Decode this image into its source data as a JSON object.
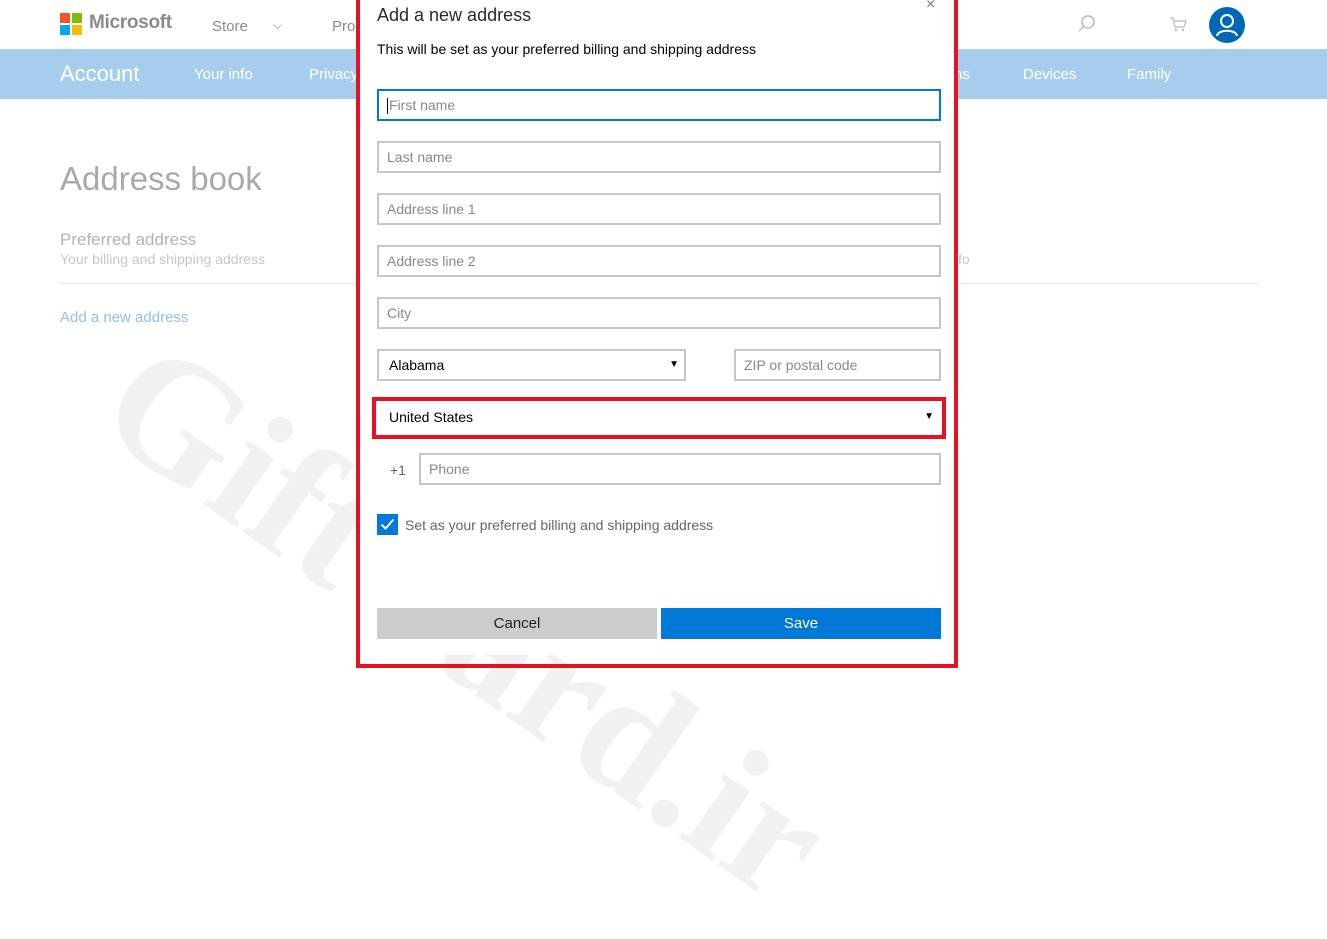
{
  "brand": {
    "name": "Microsoft",
    "logo_colors": [
      "#f35325",
      "#81bc06",
      "#05a6f0",
      "#ffba08"
    ]
  },
  "topnav": {
    "items": [
      "Store",
      "Pro"
    ]
  },
  "account_bar": {
    "title": "Account",
    "links": [
      "Your info",
      "Privacy",
      "ns",
      "Devices",
      "Family"
    ]
  },
  "page": {
    "title": "Address book",
    "preferred_label": "Preferred address",
    "preferred_sub": "Your billing and shipping address",
    "preferred_sub_right": "fo",
    "add_link": "Add a new address"
  },
  "watermark": "GiftCard.ir",
  "modal": {
    "title": "Add a new address",
    "close_glyph": "×",
    "subtitle": "This will be set as your preferred billing and shipping address",
    "fields": {
      "first_name": "First name",
      "last_name": "Last name",
      "address1": "Address line 1",
      "address2": "Address line 2",
      "city": "City",
      "zip": "ZIP or postal code",
      "phone": "Phone"
    },
    "state_selected": "Alabama",
    "country_selected": "United States",
    "phone_prefix": "+1",
    "checkbox_label": "Set as your preferred billing and shipping address",
    "checkbox_checked": true,
    "cancel_label": "Cancel",
    "save_label": "Save"
  },
  "colors": {
    "accent": "#0078d7",
    "highlight": "#e81123",
    "account_bar": "#a7cdee"
  },
  "icons": [
    "search-icon",
    "cart-icon",
    "user-icon",
    "chevron-down-icon",
    "checkmark-icon",
    "close-icon"
  ]
}
